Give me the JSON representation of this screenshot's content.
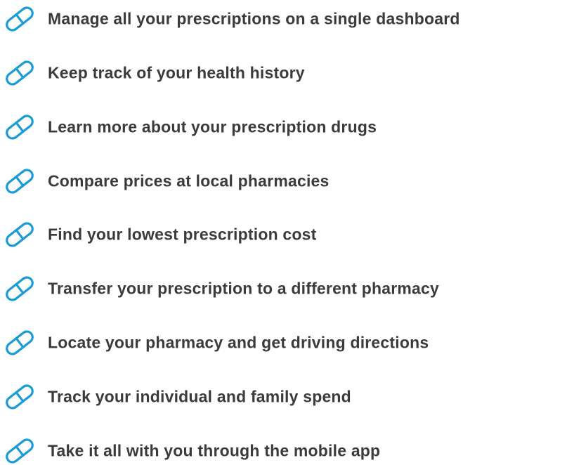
{
  "icon": {
    "name": "pill-capsule-icon",
    "stroke_color": "#1a9bd6",
    "fill_color": "#ffffff"
  },
  "text_color": "#3b3b3b",
  "features": [
    {
      "label": "Manage all your prescriptions on a single dashboard"
    },
    {
      "label": "Keep track of your health history"
    },
    {
      "label": "Learn more about your prescription drugs"
    },
    {
      "label": "Compare prices at local pharmacies"
    },
    {
      "label": "Find your lowest prescription cost"
    },
    {
      "label": "Transfer your prescription to a different pharmacy"
    },
    {
      "label": "Locate your pharmacy and get driving directions"
    },
    {
      "label": "Track your individual and family spend"
    },
    {
      "label": "Take it all with you through the mobile app"
    }
  ]
}
